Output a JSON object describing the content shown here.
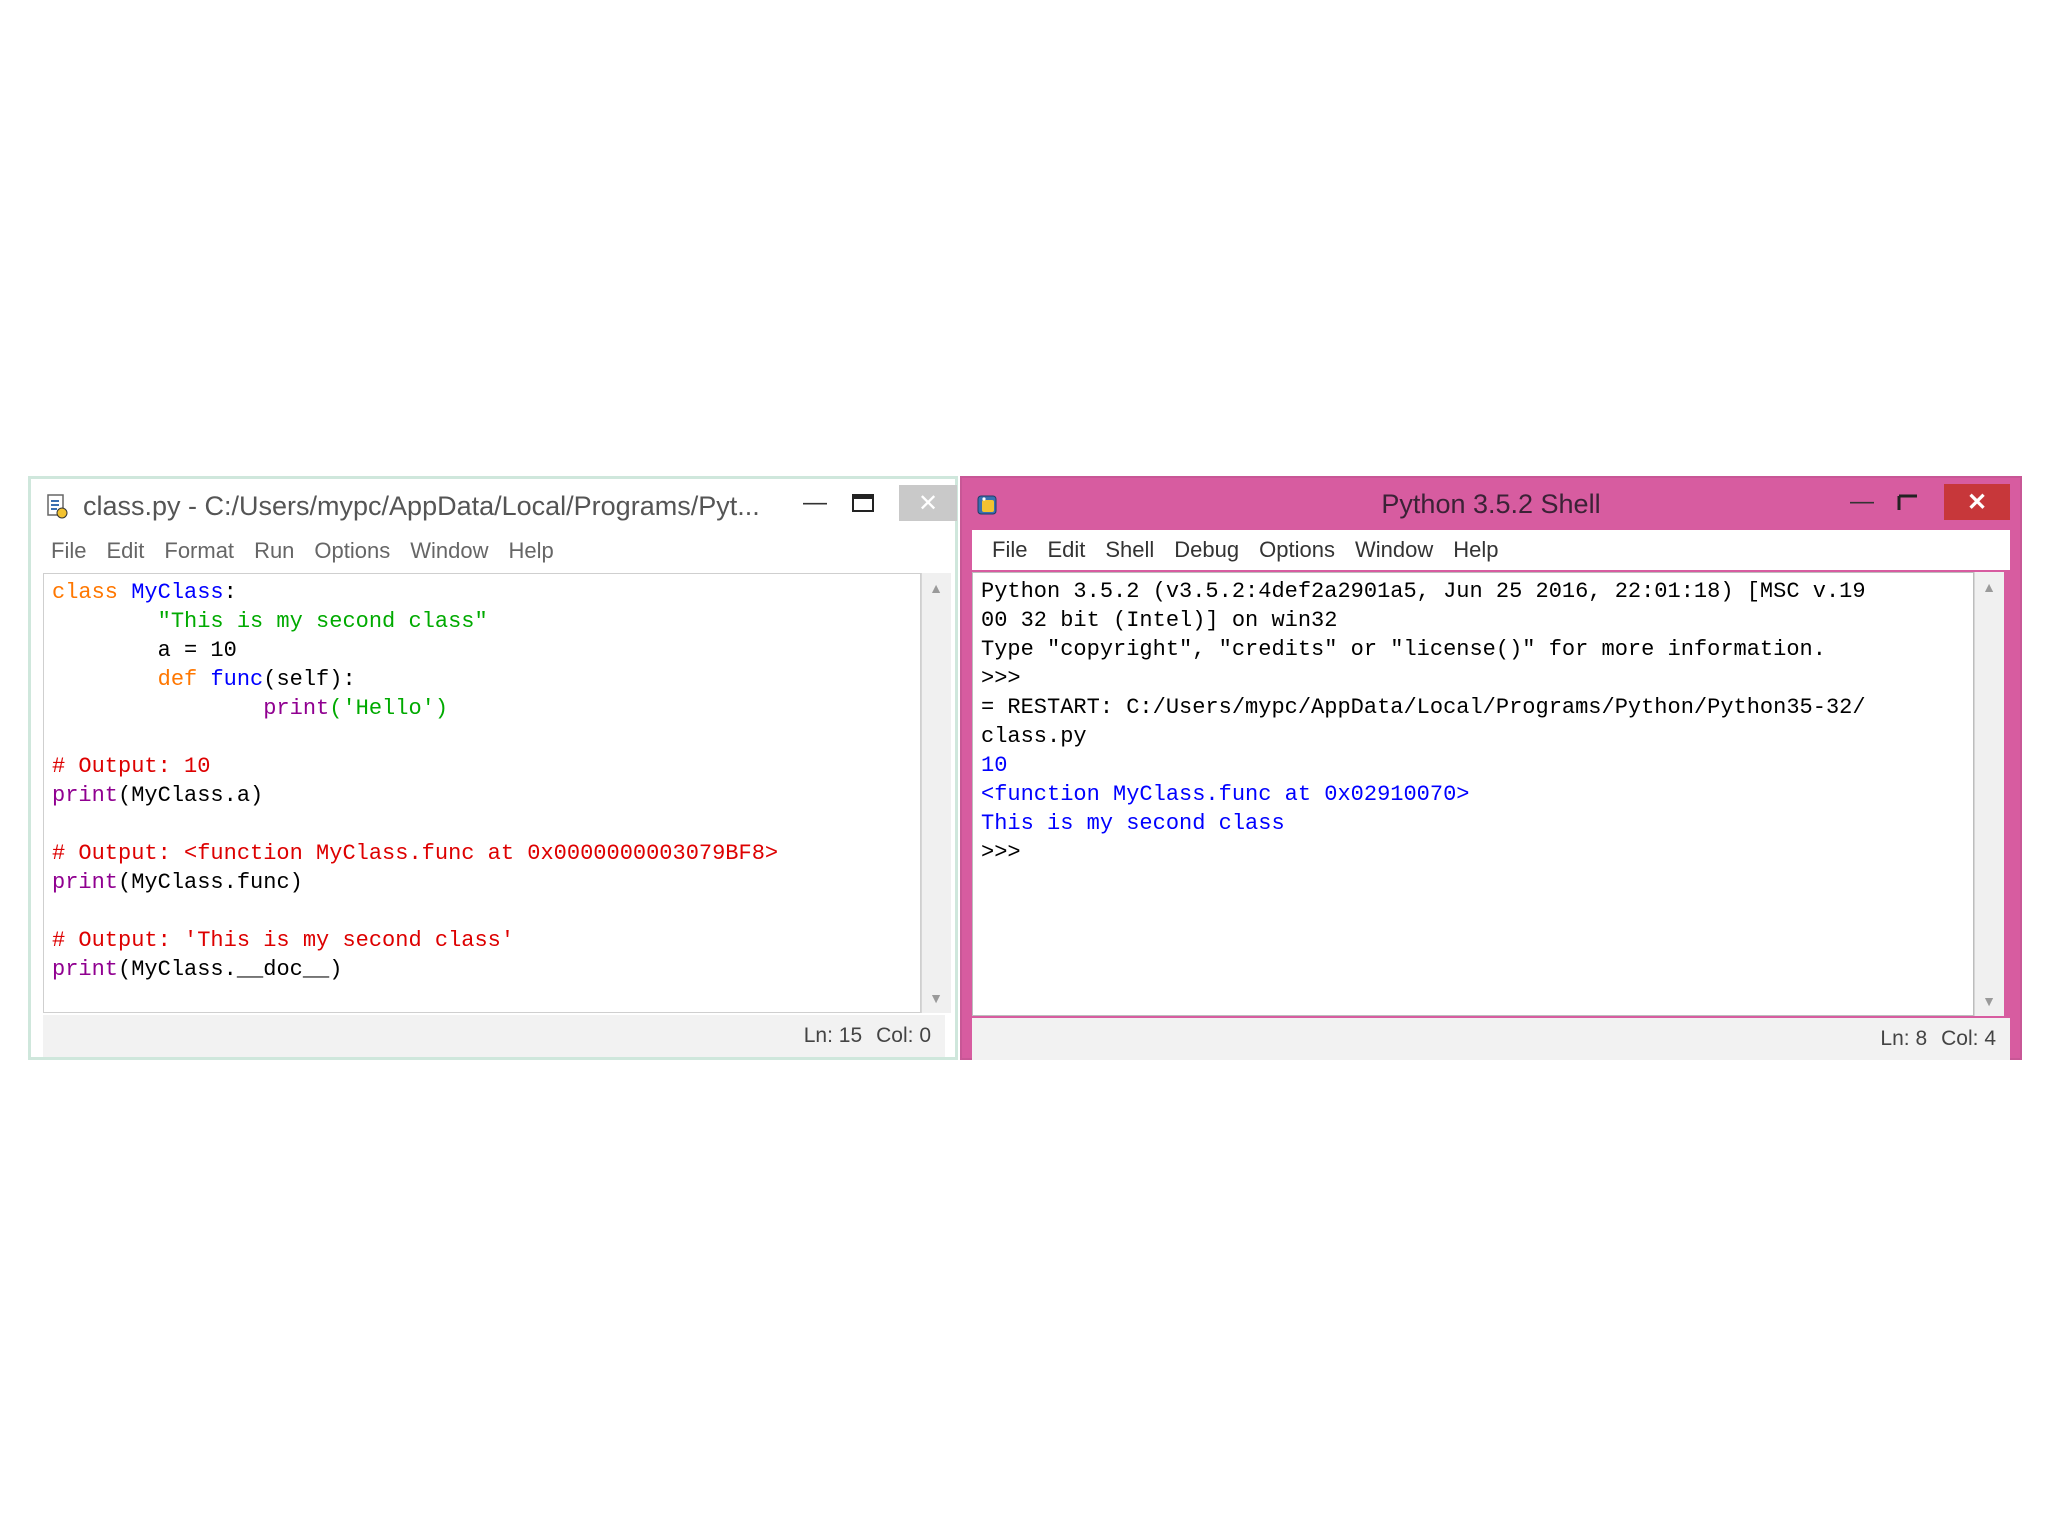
{
  "editor": {
    "title": "class.py - C:/Users/mypc/AppData/Local/Programs/Pyt...",
    "menu": [
      "File",
      "Edit",
      "Format",
      "Run",
      "Options",
      "Window",
      "Help"
    ],
    "code_lines": [
      [
        {
          "t": "class ",
          "c": "kw"
        },
        {
          "t": "MyClass",
          "c": "def"
        },
        {
          "t": ":",
          "c": "txt"
        }
      ],
      [
        {
          "t": "        \"This is my second class\"",
          "c": "str"
        }
      ],
      [
        {
          "t": "        a = 10",
          "c": "txt"
        }
      ],
      [
        {
          "t": "        ",
          "c": "txt"
        },
        {
          "t": "def ",
          "c": "kw"
        },
        {
          "t": "func",
          "c": "def"
        },
        {
          "t": "(self):",
          "c": "txt"
        }
      ],
      [
        {
          "t": "                ",
          "c": "txt"
        },
        {
          "t": "print",
          "c": "bi"
        },
        {
          "t": "('Hello')",
          "c": "str"
        }
      ],
      [],
      [
        {
          "t": "# Output: 10",
          "c": "cmt"
        }
      ],
      [
        {
          "t": "print",
          "c": "bi"
        },
        {
          "t": "(MyClass.a)",
          "c": "txt"
        }
      ],
      [],
      [
        {
          "t": "# Output: <function MyClass.func at 0x0000000003079BF8>",
          "c": "cmt"
        }
      ],
      [
        {
          "t": "print",
          "c": "bi"
        },
        {
          "t": "(MyClass.func)",
          "c": "txt"
        }
      ],
      [],
      [
        {
          "t": "# Output: 'This is my second class'",
          "c": "cmt"
        }
      ],
      [
        {
          "t": "print",
          "c": "bi"
        },
        {
          "t": "(MyClass.__doc__)",
          "c": "txt"
        }
      ]
    ],
    "status_ln": "Ln: 15",
    "status_col": "Col: 0"
  },
  "shell": {
    "title": "Python 3.5.2 Shell",
    "menu": [
      "File",
      "Edit",
      "Shell",
      "Debug",
      "Options",
      "Window",
      "Help"
    ],
    "lines": [
      [
        {
          "t": "Python 3.5.2 (v3.5.2:4def2a2901a5, Jun 25 2016, 22:01:18) [MSC v.19",
          "c": "txt"
        }
      ],
      [
        {
          "t": "00 32 bit (Intel)] on win32",
          "c": "txt"
        }
      ],
      [
        {
          "t": "Type \"copyright\", \"credits\" or \"license()\" for more information.",
          "c": "txt"
        }
      ],
      [
        {
          "t": ">>> ",
          "c": "txt"
        }
      ],
      [
        {
          "t": "= RESTART: C:/Users/mypc/AppData/Local/Programs/Python/Python35-32/",
          "c": "txt"
        }
      ],
      [
        {
          "t": "class.py",
          "c": "txt"
        }
      ],
      [
        {
          "t": "10",
          "c": "out"
        }
      ],
      [
        {
          "t": "<function MyClass.func at 0x02910070>",
          "c": "out"
        }
      ],
      [
        {
          "t": "This is my second class",
          "c": "out"
        }
      ],
      [
        {
          "t": ">>> ",
          "c": "txt"
        }
      ]
    ],
    "status_ln": "Ln: 8",
    "status_col": "Col: 4"
  },
  "colors": {
    "shell_frame": "#d75ca0",
    "close_red": "#c7373a",
    "keyword": "#ff7700",
    "string": "#00aa00",
    "comment": "#dd0000",
    "builtin": "#900090",
    "definition": "#0000ff",
    "output": "#0000ff"
  }
}
